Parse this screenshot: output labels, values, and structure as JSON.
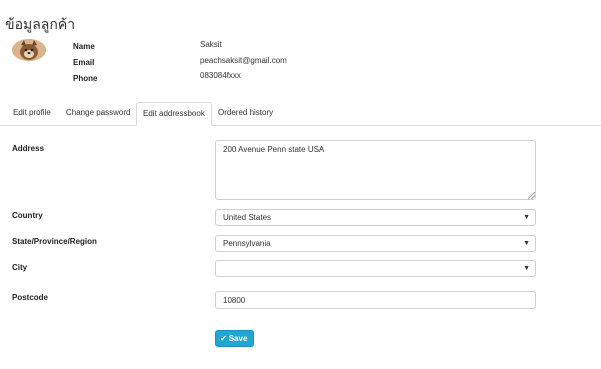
{
  "page": {
    "title": "ข้อมูลลูกค้า"
  },
  "profile": {
    "name_label": "Name",
    "name": "Saksit",
    "email_label": "Email",
    "email": "peachsaksit@gmail.com",
    "phone_label": "Phone",
    "phone": "083084fxxx"
  },
  "tabs": [
    {
      "label": "Edit profile",
      "active": false
    },
    {
      "label": "Change password",
      "active": false
    },
    {
      "label": "Edit addressbook",
      "active": true
    },
    {
      "label": "Ordered history",
      "active": false
    }
  ],
  "form": {
    "address_label": "Address",
    "address_value": "200 Avenue Penn state USA",
    "country_label": "Country",
    "country_value": "United States",
    "state_label": "State/Province/Region",
    "state_value": "Pennsylvania",
    "city_label": "City",
    "city_value": "",
    "postcode_label": "Postcode",
    "postcode_value": "10800",
    "save_label": "Save"
  },
  "icons": {
    "select_caret": "chevron-down-icon",
    "save": "check-icon"
  },
  "colors": {
    "save_button": "#1fa6d1",
    "border": "#d9d9d9"
  }
}
